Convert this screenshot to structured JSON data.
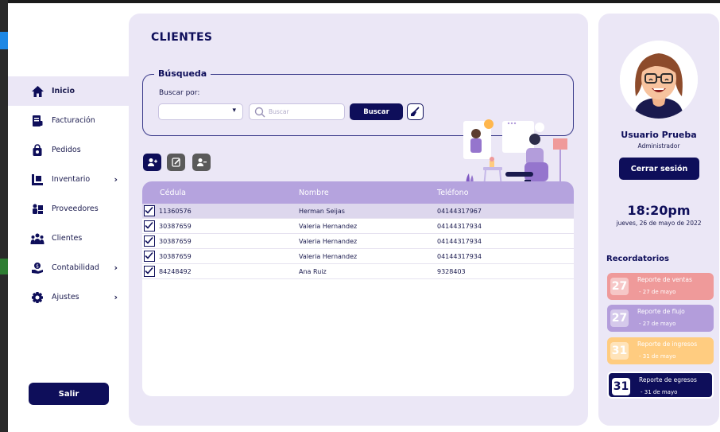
{
  "sidebar": {
    "items": [
      {
        "label": "Inicio",
        "icon": "home-icon"
      },
      {
        "label": "Facturación",
        "icon": "invoice-icon"
      },
      {
        "label": "Pedidos",
        "icon": "bag-icon"
      },
      {
        "label": "Inventario",
        "icon": "inventory-icon"
      },
      {
        "label": "Proveedores",
        "icon": "supplier-icon"
      },
      {
        "label": "Clientes",
        "icon": "clients-icon"
      },
      {
        "label": "Contabilidad",
        "icon": "accounting-icon"
      },
      {
        "label": "Ajustes",
        "icon": "gear-icon"
      }
    ],
    "logout_label": "Salir"
  },
  "main": {
    "title": "CLIENTES",
    "search": {
      "legend": "Búsqueda",
      "search_by_label": "Buscar por:",
      "select_value": "",
      "placeholder": "Buscar",
      "button_label": "Buscar"
    },
    "table": {
      "headers": [
        "Cédula",
        "Nombre",
        "Teléfono"
      ],
      "rows": [
        {
          "cedula": "11360576",
          "nombre": "Herman Seijas",
          "telefono": "04144317967",
          "selected": true
        },
        {
          "cedula": "30387659",
          "nombre": "Valeria Hernandez",
          "telefono": "04144317934",
          "selected": false
        },
        {
          "cedula": "30387659",
          "nombre": "Valeria Hernandez",
          "telefono": "04144317934",
          "selected": false
        },
        {
          "cedula": "30387659",
          "nombre": "Valeria Hernandez",
          "telefono": "04144317934",
          "selected": false
        },
        {
          "cedula": "84248492",
          "nombre": "Ana Ruiz",
          "telefono": "9328403",
          "selected": false
        }
      ]
    }
  },
  "user": {
    "name": "Usuario Prueba",
    "role": "Administrador",
    "logout_label": "Cerrar sesión"
  },
  "clock": {
    "time": "18:20pm",
    "date": "jueves, 26 de mayo de 2022"
  },
  "reminders": {
    "title": "Recordatorios",
    "items": [
      {
        "day": "27",
        "title": "Reporte de ventas",
        "date": "- 27 de mayo",
        "color": "#ef9a9a"
      },
      {
        "day": "27",
        "title": "Reporte de flujo",
        "date": "- 27 de mayo",
        "color": "#b39ddb"
      },
      {
        "day": "31",
        "title": "Reporte de ingresos",
        "date": "- 31 de mayo",
        "color": "#ffcc80"
      },
      {
        "day": "31",
        "title": "Reporte de egresos",
        "date": "- 31 de mayo",
        "color": "#0e0e5a"
      }
    ]
  },
  "colors": {
    "primary": "#0e0e5a",
    "panel": "#ebe7f6",
    "table_header": "#b5a3de"
  }
}
